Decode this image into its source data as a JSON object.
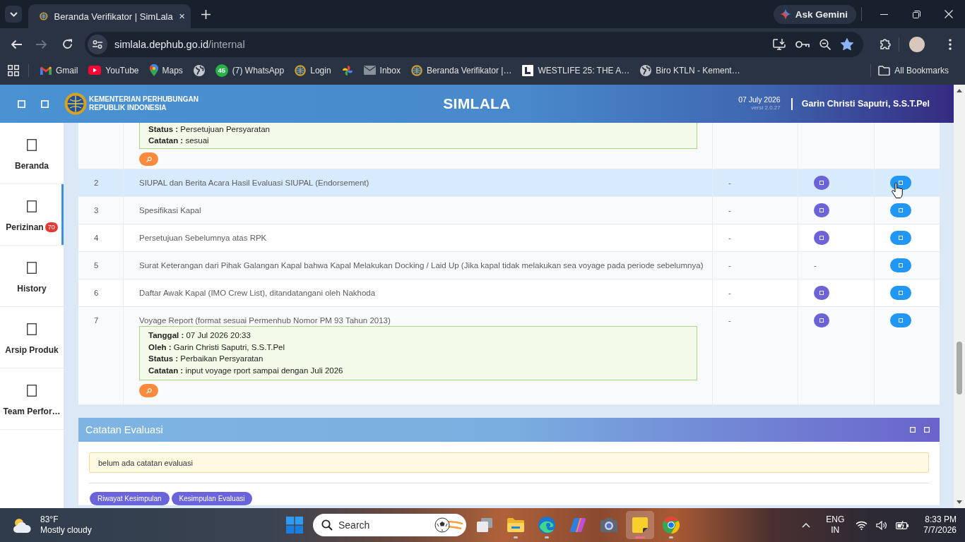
{
  "browser": {
    "tabs": [
      {
        "title": "Beranda Verifikator | SimLala",
        "selected": true
      }
    ],
    "ask_gemini": "Ask Gemini",
    "nav": [
      {
        "kind": "back",
        "disabled": false
      },
      {
        "kind": "forward",
        "disabled": true
      },
      {
        "kind": "reload",
        "disabled": false
      }
    ],
    "address": {
      "host": "simlala.dephub.go.id",
      "path": "/internal",
      "starred": true
    },
    "bookmarks": [
      {
        "kind": "gmail",
        "label": "Gmail"
      },
      {
        "kind": "youtube",
        "label": "YouTube"
      },
      {
        "kind": "maps",
        "label": "Maps"
      },
      {
        "kind": "globe"
      },
      {
        "kind": "whatsapp",
        "badge": "45",
        "label": "(7) WhatsApp"
      },
      {
        "kind": "emblem",
        "label": "Login"
      },
      {
        "kind": "pinwheel"
      },
      {
        "kind": "mail",
        "label": "Inbox"
      },
      {
        "kind": "emblem",
        "label": "Beranda Verifikator |…"
      },
      {
        "kind": "letter",
        "label": "WESTLIFE 25: THE A…"
      },
      {
        "kind": "globe",
        "label": "Biro KTLN - Kement…"
      }
    ],
    "all_bookmarks": "All Bookmarks"
  },
  "header": {
    "org_lines": [
      "KEMENTERIAN PERHUBUNGAN",
      "REPUBLIK INDONESIA"
    ],
    "title": "SIMLALA",
    "date": "07 July 2026",
    "version": "versi 2.0.27",
    "user": "Garin Christi Saputri, S.S.T.Pel"
  },
  "sidebar": {
    "items": [
      {
        "label": "Beranda",
        "selected": false
      },
      {
        "label": "Perizinan",
        "badge": "70",
        "selected": true
      },
      {
        "label": "History",
        "selected": false
      },
      {
        "label": "Arsip Produk",
        "selected": false
      },
      {
        "label": "Team Perfor…",
        "selected": false
      }
    ]
  },
  "table": {
    "rows": [
      {
        "log": [
          {
            "label": "Status :",
            "value": "Persetujuan Persyaratan"
          },
          {
            "label": "Catatan :",
            "value": "sesuai"
          }
        ],
        "preview_button": true,
        "highlighted": false
      },
      {
        "number": "2",
        "document": "SIUPAL dan Berita Acara Hasil Evaluasi SIUPAL (Endorsement)",
        "column_3": "-",
        "column_4": {
          "kind": "button"
        },
        "column_5": {
          "kind": "button"
        },
        "highlighted": true
      },
      {
        "number": "3",
        "document": "Spesifikasi Kapal",
        "column_3": "-",
        "column_4": {
          "kind": "button"
        },
        "column_5": {
          "kind": "button"
        },
        "highlighted": false
      },
      {
        "number": "4",
        "document": "Persetujuan Sebelumnya atas RPK",
        "column_3": "-",
        "column_4": {
          "kind": "button"
        },
        "column_5": {
          "kind": "button"
        },
        "highlighted": false
      },
      {
        "number": "5",
        "document": "Surat Keterangan dari Pihak Galangan Kapal bahwa Kapal Melakukan Docking / Laid Up (Jika kapal tidak melakukan sea voyage pada periode sebelumnya)",
        "column_3": "-",
        "column_4": {
          "kind": "text",
          "text": "-"
        },
        "column_5": {
          "kind": "button"
        },
        "highlighted": false
      },
      {
        "number": "6",
        "document": "Daftar Awak Kapal (IMO Crew List), ditandatangani oleh Nakhoda",
        "column_3": "-",
        "column_4": {
          "kind": "button"
        },
        "column_5": {
          "kind": "button"
        },
        "highlighted": false
      },
      {
        "number": "7",
        "document": "Voyage Report (format sesuai Permenhub Nomor PM 93 Tahun 2013)",
        "column_3": "-",
        "column_4": {
          "kind": "button"
        },
        "column_5": {
          "kind": "button"
        },
        "log": [
          {
            "label": "Tanggal :",
            "value": "07 Jul 2026 20:33"
          },
          {
            "label": "Oleh :",
            "value": "Garin Christi Saputri, S.S.T.Pel"
          },
          {
            "label": "Status :",
            "value": "Perbaikan Persyaratan"
          },
          {
            "label": "Catatan :",
            "value": "input voyage rport sampai dengan Juli 2026"
          }
        ],
        "preview_button": true,
        "highlighted": false
      }
    ]
  },
  "evaluation": {
    "title": "Catatan Evaluasi",
    "message": "belum ada catatan evaluasi",
    "buttons": [
      "Riwayat Kesimpulan",
      "Kesimpulan Evaluasi"
    ]
  },
  "taskbar": {
    "weather": {
      "temperature": "83°F",
      "condition": "Mostly cloudy"
    },
    "search": {
      "placeholder": "Search"
    },
    "apps": [
      {
        "kind": "taskview",
        "running": false,
        "active": false
      },
      {
        "kind": "explorer",
        "running": true,
        "active": false
      },
      {
        "kind": "edge",
        "running": true,
        "active": false
      },
      {
        "kind": "copilot",
        "running": false,
        "active": false
      },
      {
        "kind": "camera",
        "running": false,
        "active": false
      },
      {
        "kind": "notes",
        "running": true,
        "active": true
      },
      {
        "kind": "chrome",
        "running": true,
        "active": false
      }
    ],
    "language": "ENG",
    "region": "IN",
    "time": "8:33 PM",
    "date": "7/7/2026"
  }
}
